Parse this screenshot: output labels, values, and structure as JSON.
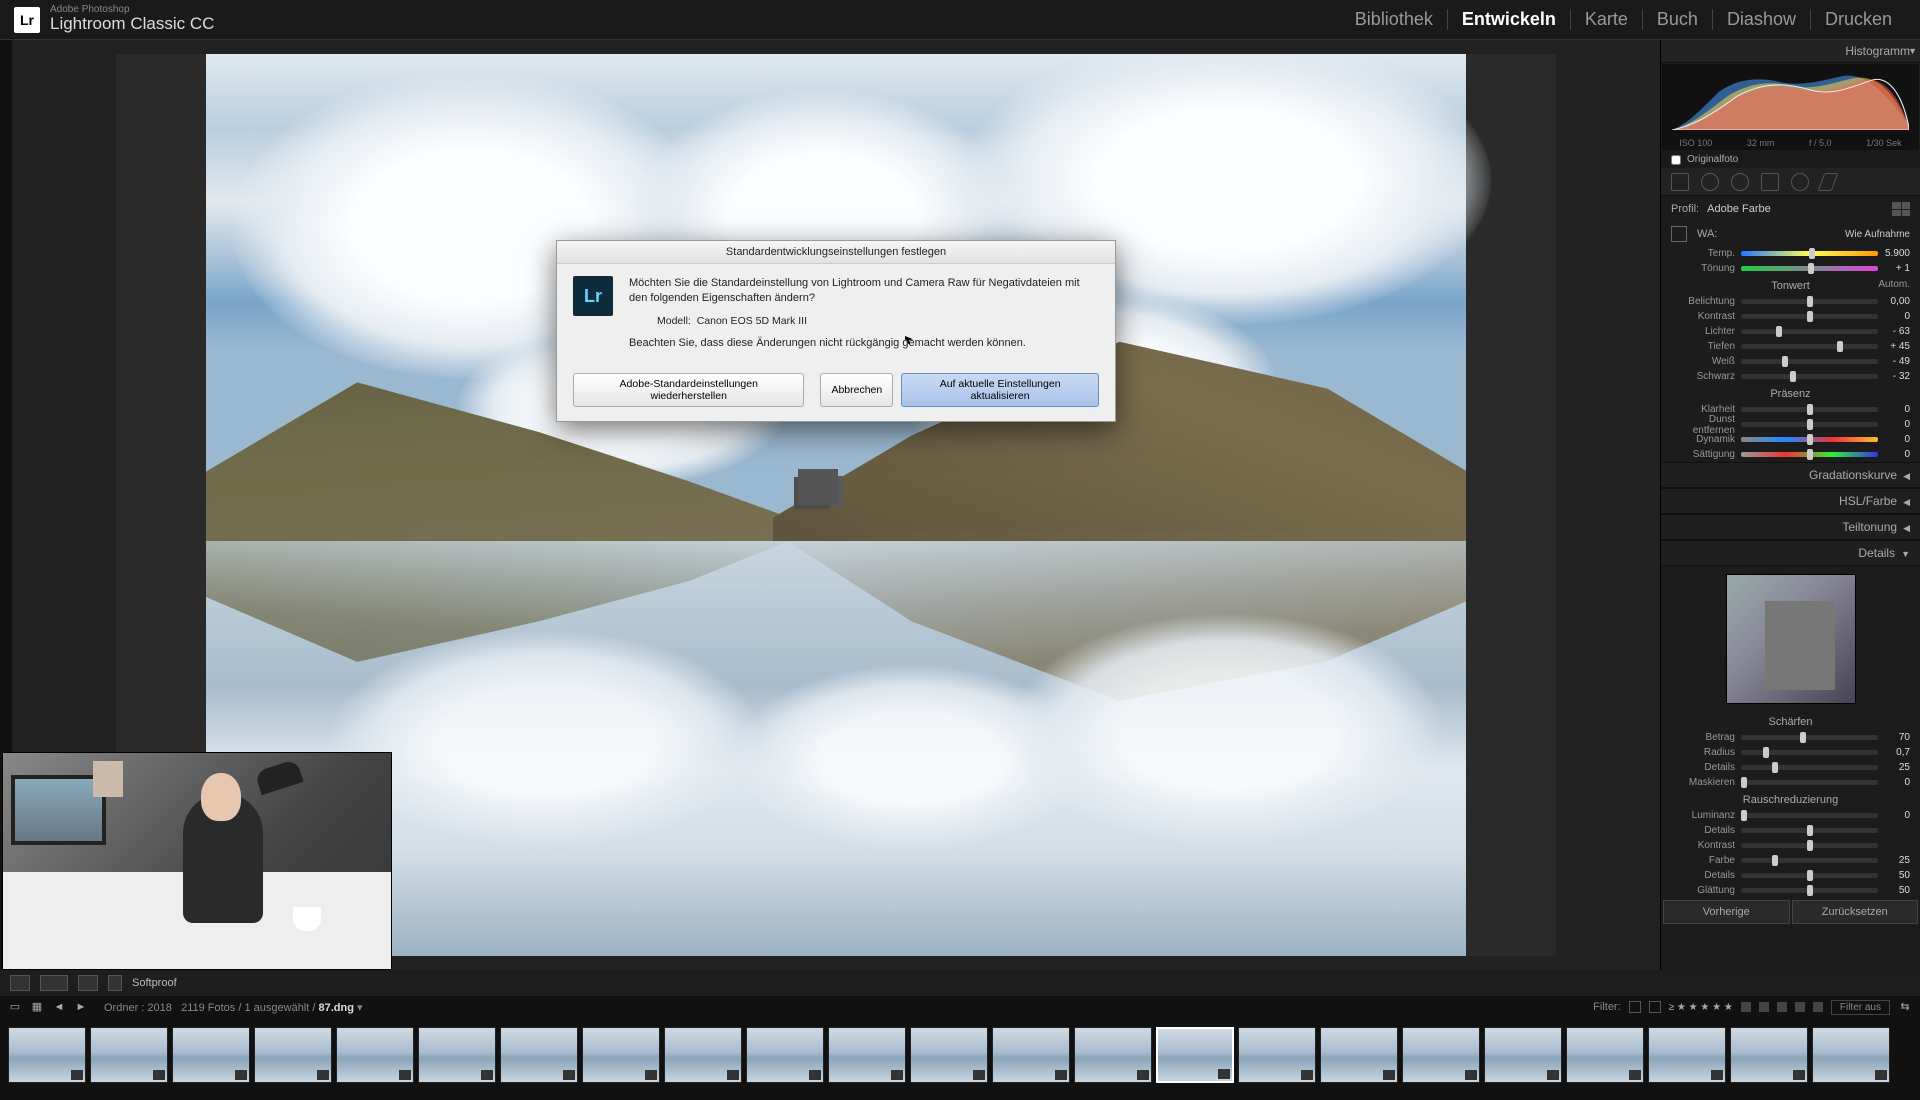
{
  "brand": {
    "small": "Adobe Photoshop",
    "name": "Lightroom Classic CC",
    "logo": "Lr"
  },
  "modules": {
    "items": [
      "Bibliothek",
      "Entwickeln",
      "Karte",
      "Buch",
      "Diashow",
      "Drucken"
    ],
    "active_index": 1
  },
  "under_toolbar": {
    "softproof": "Softproof"
  },
  "film_info": {
    "folder_label": "Ordner :",
    "year": "2018",
    "count": "2119 Fotos /",
    "selected": "1 ausgewählt /",
    "filename": "87.dng",
    "filter_label": "Filter:",
    "filter_off": "Filter aus"
  },
  "right_panel": {
    "histogram_label": "Histogramm",
    "hist_info": {
      "iso": "ISO 100",
      "focal": "32 mm",
      "aperture": "f / 5,0",
      "shutter": "1/30 Sek"
    },
    "original_checkbox": "Originalfoto",
    "profile": {
      "label": "Profil:",
      "value": "Adobe Farbe"
    },
    "wb": {
      "picker_label": "WA:",
      "mode": "Wie Aufnahme"
    },
    "sliders_wb": [
      {
        "label": "Temp.",
        "value": "5.900",
        "pos": 52,
        "grad": "grad-temp"
      },
      {
        "label": "Tönung",
        "value": "+ 1",
        "pos": 51,
        "grad": "grad-tint"
      }
    ],
    "tonwert_hdr": "Tonwert",
    "auto_label": "Autom.",
    "sliders_tone": [
      {
        "label": "Belichtung",
        "value": "0,00",
        "pos": 50
      },
      {
        "label": "Kontrast",
        "value": "0",
        "pos": 50
      },
      {
        "label": "Lichter",
        "value": "- 63",
        "pos": 28
      },
      {
        "label": "Tiefen",
        "value": "+ 45",
        "pos": 72
      },
      {
        "label": "Weiß",
        "value": "- 49",
        "pos": 32
      },
      {
        "label": "Schwarz",
        "value": "- 32",
        "pos": 38
      }
    ],
    "presence_hdr": "Präsenz",
    "sliders_presence": [
      {
        "label": "Klarheit",
        "value": "0",
        "pos": 50
      },
      {
        "label": "Dunst entfernen",
        "value": "0",
        "pos": 50
      },
      {
        "label": "Dynamik",
        "value": "0",
        "pos": 50,
        "grad": "grad-vib"
      },
      {
        "label": "Sättigung",
        "value": "0",
        "pos": 50,
        "grad": "grad-sat"
      }
    ],
    "collapsed": [
      "Gradationskurve",
      "HSL/Farbe",
      "Teiltonung"
    ],
    "details_hdr": "Details",
    "sharpen_hdr": "Schärfen",
    "sliders_sharpen": [
      {
        "label": "Betrag",
        "value": "70",
        "pos": 45
      },
      {
        "label": "Radius",
        "value": "0,7",
        "pos": 18
      },
      {
        "label": "Details",
        "value": "25",
        "pos": 25
      },
      {
        "label": "Maskieren",
        "value": "0",
        "pos": 2
      }
    ],
    "noise_hdr": "Rauschreduzierung",
    "sliders_noise": [
      {
        "label": "Luminanz",
        "value": "0",
        "pos": 2
      },
      {
        "label": "Details",
        "value": "",
        "pos": 50
      },
      {
        "label": "Kontrast",
        "value": "",
        "pos": 50
      },
      {
        "label": "Farbe",
        "value": "25",
        "pos": 25
      },
      {
        "label": "Details",
        "value": "50",
        "pos": 50
      },
      {
        "label": "Glättung",
        "value": "50",
        "pos": 50
      }
    ],
    "prev_btn": "Vorherige",
    "reset_btn": "Zurücksetzen"
  },
  "dialog": {
    "title": "Standardentwicklungseinstellungen festlegen",
    "line1": "Möchten Sie die Standardeinstellung von Lightroom und Camera Raw für Negativdateien mit den folgenden Eigenschaften ändern?",
    "model_label": "Modell:",
    "model_value": "Canon EOS 5D Mark III",
    "line2": "Beachten Sie, dass diese Änderungen nicht rückgängig gemacht werden können.",
    "btn_restore": "Adobe-Standardeinstellungen wiederherstellen",
    "btn_cancel": "Abbrechen",
    "btn_update": "Auf aktuelle Einstellungen aktualisieren"
  },
  "filmstrip": {
    "count": 23,
    "selected_index": 14
  }
}
